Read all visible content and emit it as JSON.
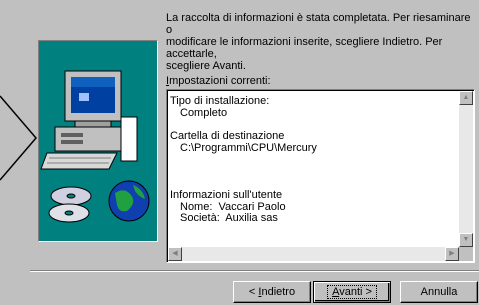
{
  "intro_text": "La raccolta di informazioni è stata completata. Per riesaminare o\nmodificare le informazioni inserite, scegliere Indietro. Per accettarle,\nscegliere Avanti.",
  "settings": {
    "label_accel": "I",
    "label_rest": "mpostazioni correnti:",
    "lines": {
      "install_type_heading": "Tipo di installazione:",
      "install_type_value": "Completo",
      "dest_heading": "Cartella di destinazione",
      "dest_value": "C:\\Programmi\\CPU\\Mercury",
      "user_heading": "Informazioni sull'utente",
      "user_name": "Nome:  Vaccari Paolo",
      "user_company": "Società:  Auxilia sas"
    }
  },
  "buttons": {
    "back_prefix": "< ",
    "back_accel": "I",
    "back_rest": "ndietro",
    "next_accel": "A",
    "next_rest": "vanti >",
    "cancel": "Annulla"
  },
  "colors": {
    "dialog_bg": "#c0c0c0",
    "art_bg": "#00807f"
  },
  "icons": {
    "wizard_art": "computer-cd-globe-illustration",
    "arrow": "chevron-right-outline"
  }
}
